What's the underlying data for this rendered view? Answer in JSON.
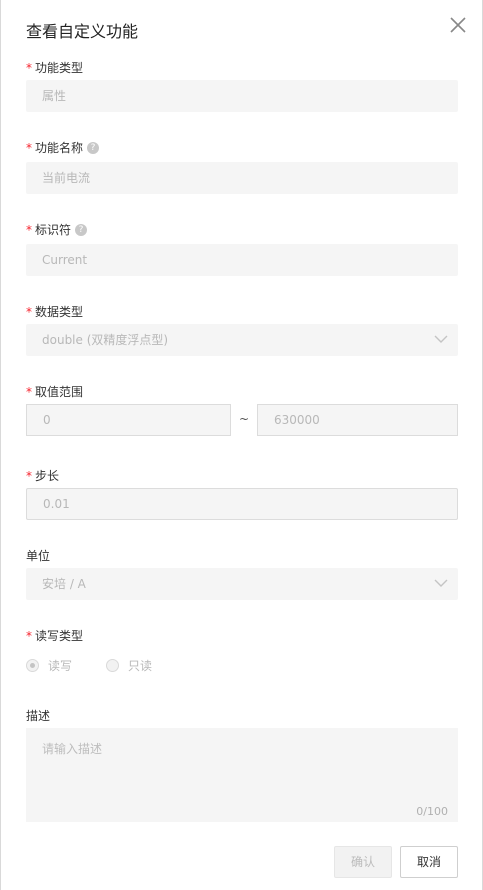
{
  "dialog": {
    "title": "查看自定义功能"
  },
  "form": {
    "function_type": {
      "label": "功能类型",
      "value": "属性"
    },
    "function_name": {
      "label": "功能名称",
      "value": "当前电流"
    },
    "identifier": {
      "label": "标识符",
      "value": "Current"
    },
    "data_type": {
      "label": "数据类型",
      "value": "double (双精度浮点型)"
    },
    "value_range": {
      "label": "取值范围",
      "min": "0",
      "separator": "~",
      "max": "630000"
    },
    "step": {
      "label": "步长",
      "value": "0.01"
    },
    "unit": {
      "label": "单位",
      "value": "安培 / A"
    },
    "rw_type": {
      "label": "读写类型",
      "options": [
        {
          "label": "读写",
          "checked": true
        },
        {
          "label": "只读",
          "checked": false
        }
      ]
    },
    "description": {
      "label": "描述",
      "placeholder": "请输入描述",
      "counter": "0/100"
    }
  },
  "footer": {
    "confirm_label": "确认",
    "cancel_label": "取消"
  },
  "colors": {
    "required": "#f5222d",
    "field_bg": "#f5f5f5"
  }
}
